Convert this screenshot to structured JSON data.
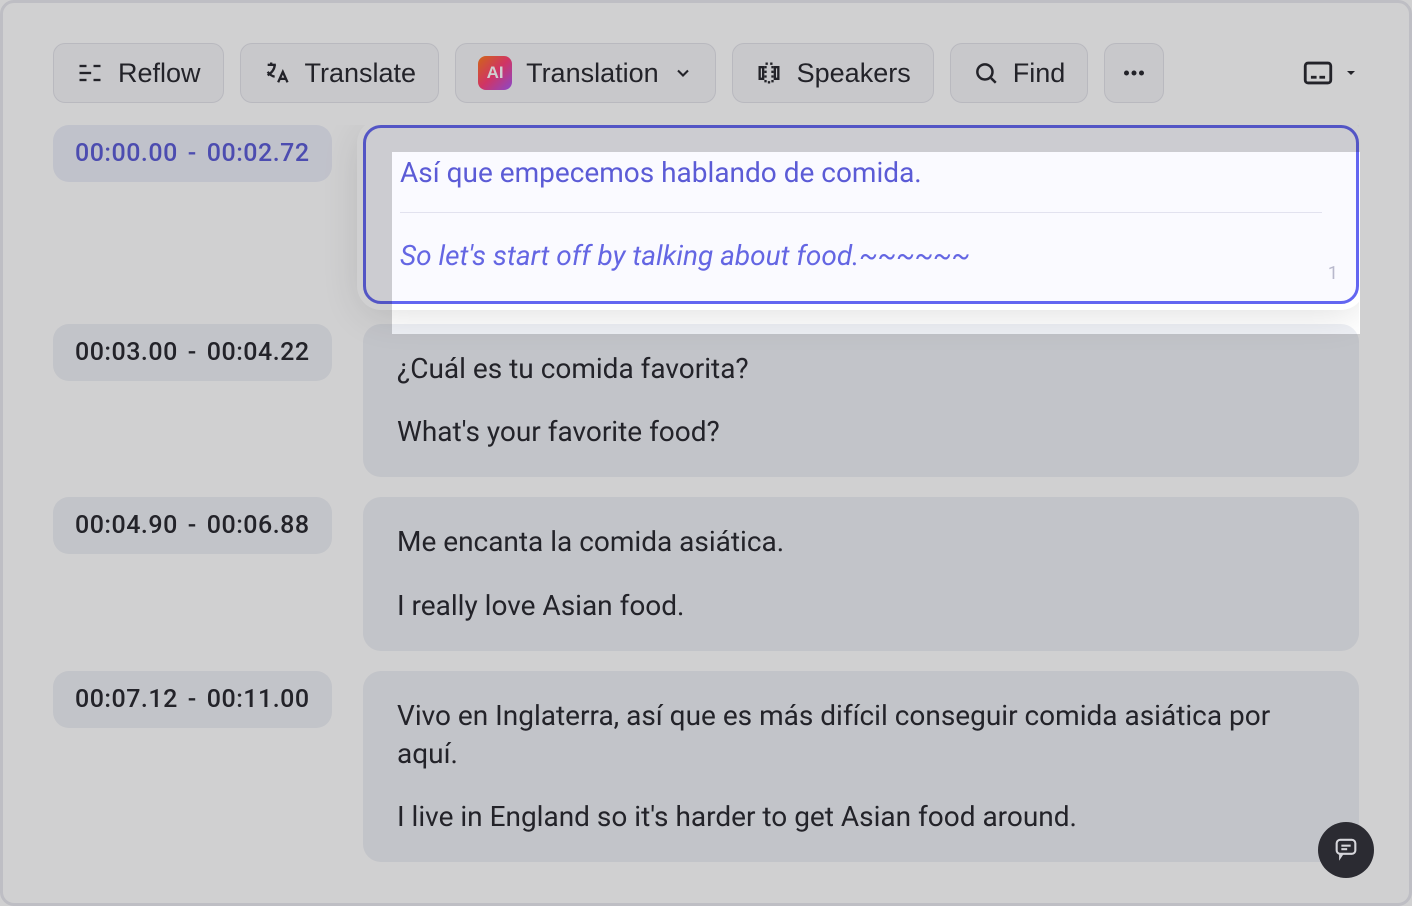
{
  "toolbar": {
    "reflow_label": "Reflow",
    "translate_label": "Translate",
    "translation_label": "Translation",
    "speakers_label": "Speakers",
    "find_label": "Find"
  },
  "segments": [
    {
      "start": "00:00.00",
      "end": "00:02.72",
      "source": "Así que empecemos hablando de comida.",
      "target": "So let's start off by talking about food.~~~~~~",
      "index": "1",
      "active": true
    },
    {
      "start": "00:03.00",
      "end": "00:04.22",
      "source": "¿Cuál es tu comida favorita?",
      "target": "What's your favorite food?",
      "active": false
    },
    {
      "start": "00:04.90",
      "end": "00:06.88",
      "source": "Me encanta la comida asiática.",
      "target": "I really love Asian food.",
      "active": false
    },
    {
      "start": "00:07.12",
      "end": "00:11.00",
      "source": "Vivo en Inglaterra, así que es más difícil conseguir comida asiática por aquí.",
      "target": "I live in England so it's harder to get Asian food around.",
      "active": false
    }
  ]
}
